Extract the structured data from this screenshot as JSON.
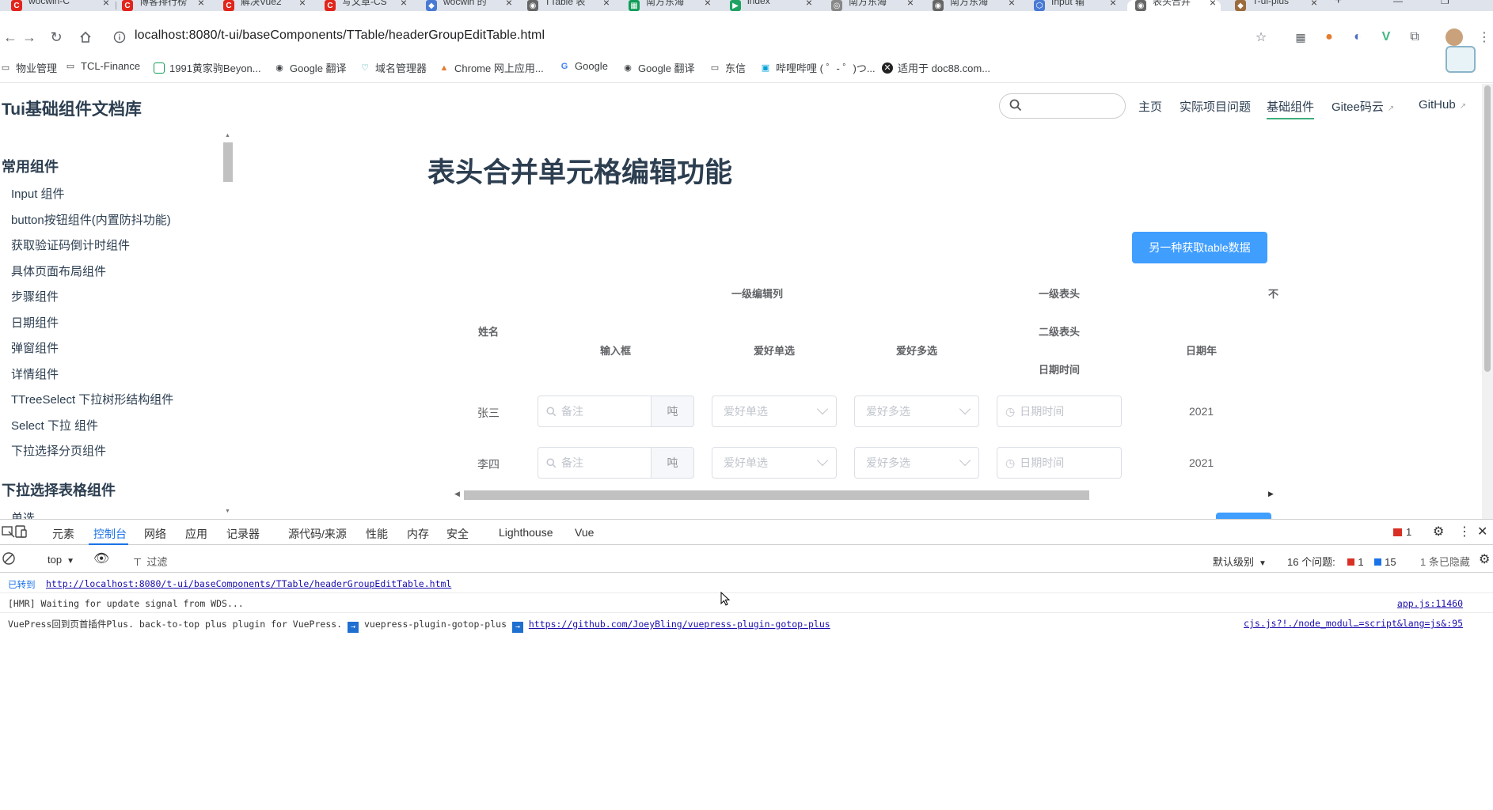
{
  "browser": {
    "tabs": [
      {
        "title": "wocwin-C",
        "icon": "C",
        "color": "#e1251b"
      },
      {
        "title": "博客排行榜",
        "icon": "C",
        "color": "#e1251b"
      },
      {
        "title": "解决Vue2",
        "icon": "C",
        "color": "#e1251b"
      },
      {
        "title": "写文章-CS",
        "icon": "C",
        "color": "#e1251b"
      },
      {
        "title": "wocwin 的",
        "icon": "◆",
        "color": "#4a7bd4"
      },
      {
        "title": "TTable 表",
        "icon": "◉",
        "color": "#555"
      },
      {
        "title": "南方东海",
        "icon": "▦",
        "color": "#0f9d58"
      },
      {
        "title": "index",
        "icon": "▶",
        "color": "#1ea362"
      },
      {
        "title": "南方东海",
        "icon": "◎",
        "color": "#555"
      },
      {
        "title": "南方东海",
        "icon": "◉",
        "color": "#555"
      },
      {
        "title": "Input 输",
        "icon": "⬡",
        "color": "#4a7bd4"
      },
      {
        "title": "表头合并",
        "icon": "◉",
        "color": "#555",
        "active": true
      },
      {
        "title": "T-ui-plus",
        "icon": "◆",
        "color": "#9c6b3c"
      }
    ],
    "new_tab": "+",
    "url": "localhost:8080/t-ui/baseComponents/TTable/headerGroupEditTable.html",
    "bookmarks": [
      {
        "label": "物业管理",
        "icon": "folder-icon"
      },
      {
        "label": "TCL-Finance",
        "icon": "folder-icon"
      },
      {
        "label": "1991黄家驹Beyon...",
        "icon": "sheet-icon"
      },
      {
        "label": "Google 翻译",
        "icon": "globe-icon"
      },
      {
        "label": "域名管理器",
        "icon": "leaf-icon"
      },
      {
        "label": "Chrome 网上应用...",
        "icon": "chrome-icon"
      },
      {
        "label": "Google",
        "icon": "google-icon"
      },
      {
        "label": "Google 翻译",
        "icon": "globe-icon"
      },
      {
        "label": "东信",
        "icon": "folder-icon"
      },
      {
        "label": "哔哩哔哩 ( ゜- ゜)つ...",
        "icon": "bilibili-icon"
      },
      {
        "label": "适用于 doc88.com...",
        "icon": "doc-icon"
      }
    ]
  },
  "site": {
    "title": "Tui基础组件文档库",
    "search_placeholder": "",
    "nav": [
      {
        "label": "主页"
      },
      {
        "label": "实际项目问题"
      },
      {
        "label": "基础组件",
        "active": true
      },
      {
        "label": "Gitee码云",
        "external": true
      },
      {
        "label": "GitHub",
        "external": true
      }
    ]
  },
  "sidebar": {
    "group1": "常用组件",
    "items": [
      "Input 组件",
      "button按钮组件(内置防抖功能)",
      "获取验证码倒计时组件",
      "具体页面布局组件",
      "步骤组件",
      "日期组件",
      "弹窗组件",
      "详情组件",
      "TTreeSelect 下拉树形结构组件",
      "Select 下拉 组件",
      "下拉选择分页组件"
    ],
    "group2": "下拉选择表格组件",
    "partial_item": "单选"
  },
  "content": {
    "title": "表头合并单元格编辑功能",
    "action_button": "另一种获取table数据",
    "headers": {
      "name": "姓名",
      "level1_edit": "一级编辑列",
      "input": "输入框",
      "radio": "爱好单选",
      "multi": "爱好多选",
      "level1_head": "一级表头",
      "level2_head": "二级表头",
      "datetime": "日期时间",
      "year": "日期年",
      "cut": "不"
    },
    "rows": [
      {
        "name": "张三",
        "remark_placeholder": "备注",
        "unit": "吨",
        "radio_placeholder": "爱好单选",
        "multi_placeholder": "爱好多选",
        "date_placeholder": "日期时间",
        "year": "2021"
      },
      {
        "name": "李四",
        "remark_placeholder": "备注",
        "unit": "吨",
        "radio_placeholder": "爱好单选",
        "multi_placeholder": "爱好多选",
        "date_placeholder": "日期时间",
        "year": "2021"
      }
    ]
  },
  "devtools": {
    "tabs": [
      "元素",
      "控制台",
      "网络",
      "应用",
      "记录器",
      "源代码/来源",
      "性能",
      "内存",
      "安全",
      "Lighthouse",
      "Vue"
    ],
    "active_tab": "控制台",
    "errors_count": "1",
    "context": "top",
    "filter_label": "过滤",
    "level": "默认级别",
    "issues_label": "16 个问题:",
    "issues_err": "1",
    "issues_info": "15",
    "hidden": "1 条已隐藏",
    "logs": {
      "nav_prefix": "已转到",
      "nav_url": "http://localhost:8080/t-ui/baseComponents/TTable/headerGroupEditTable.html",
      "hmr": "[HMR] Waiting for update signal from WDS...",
      "hmr_src": "app.js:11460",
      "vp_text": "VuePress回到页首插件Plus. back-to-top plus plugin for VuePress.",
      "vp_plugin": "vuepress-plugin-gotop-plus",
      "vp_link": "https://github.com/JoeyBling/vuepress-plugin-gotop-plus",
      "vp_src": "cjs.js?!./node_modul…=script&lang=js&:95"
    }
  }
}
